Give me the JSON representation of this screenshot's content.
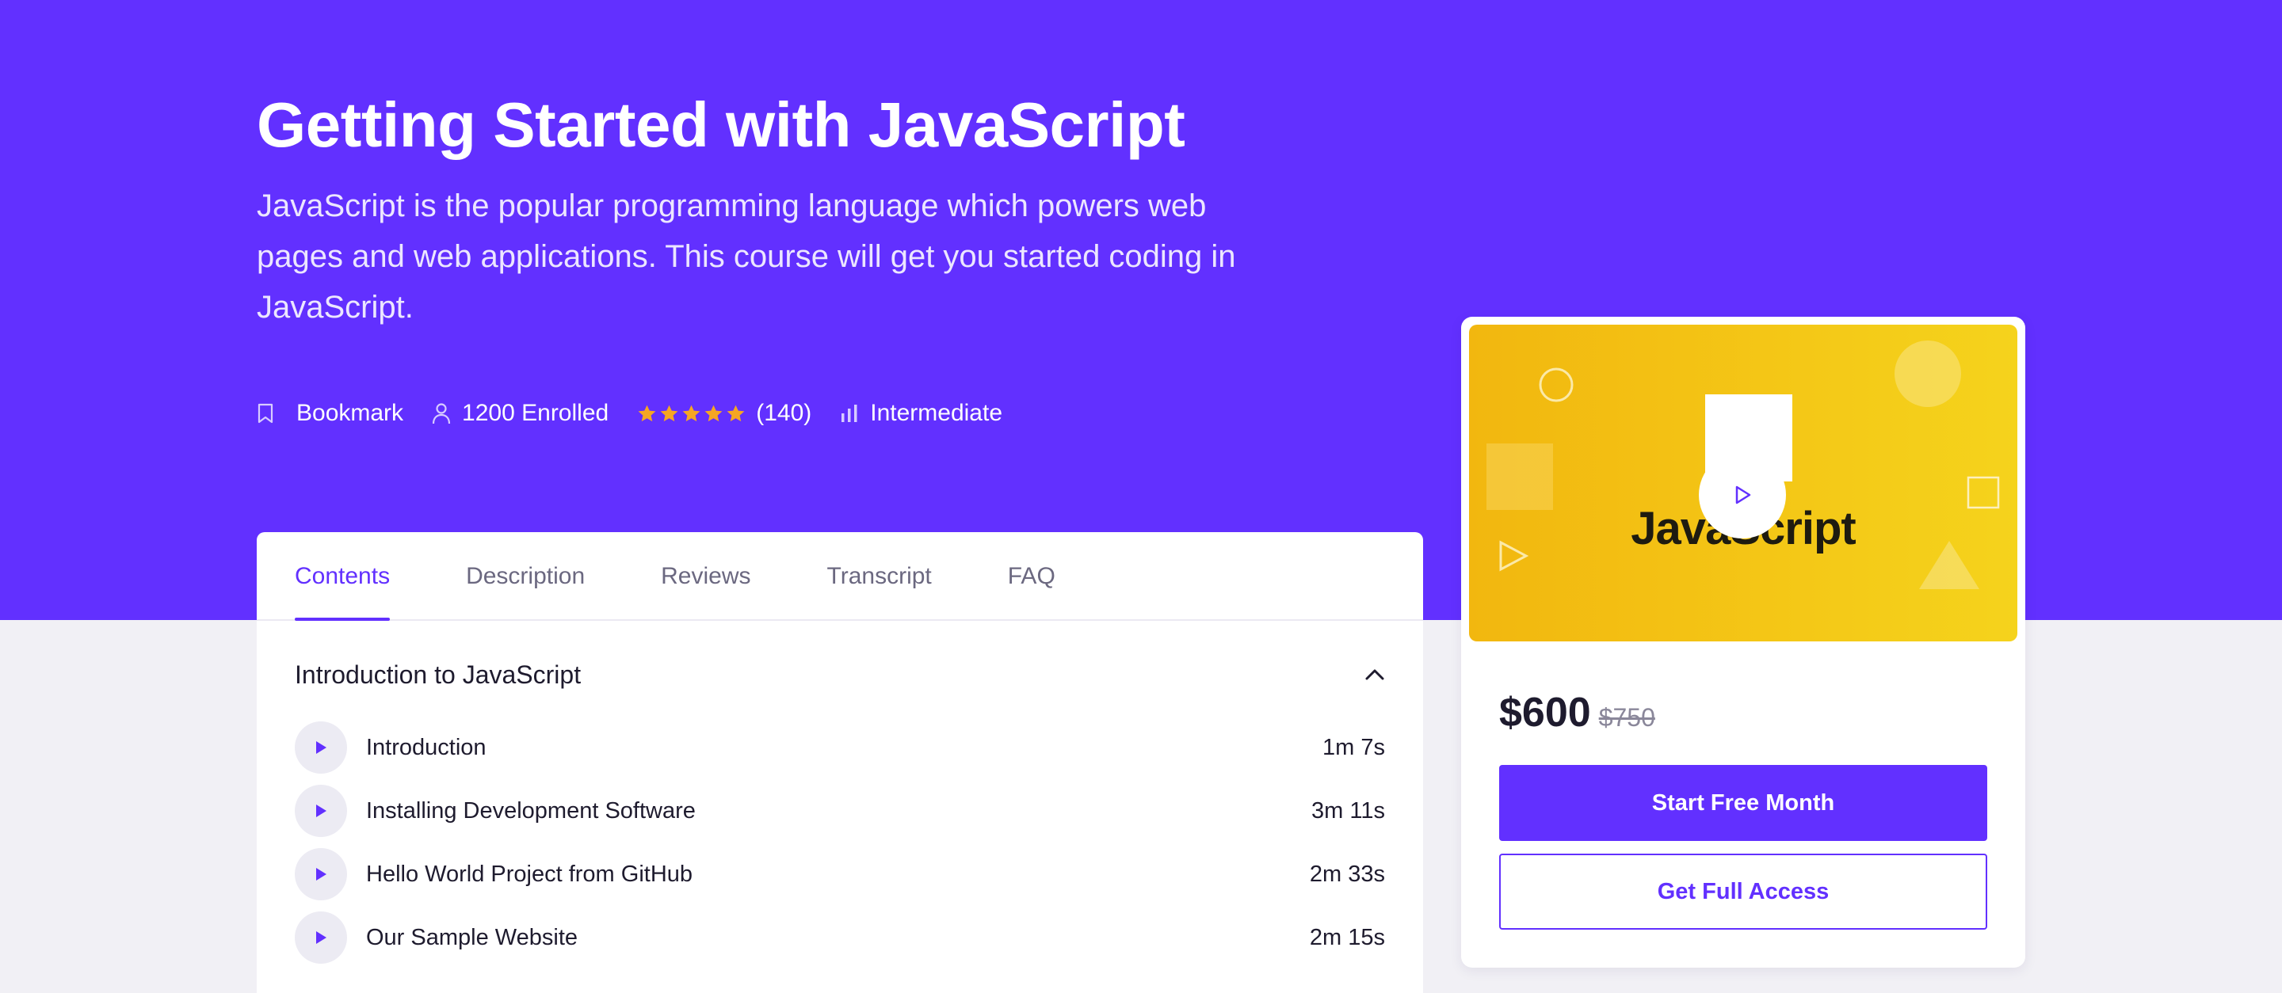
{
  "course": {
    "title": "Getting Started with JavaScript",
    "description": "JavaScript is the popular programming language which powers web pages and web applications. This course will get you started coding in JavaScript."
  },
  "meta": {
    "bookmark_label": "Bookmark",
    "enrolled_label": "1200 Enrolled",
    "rating_stars": 5,
    "rating_count": "(140)",
    "level_label": "Intermediate"
  },
  "tabs": [
    {
      "label": "Contents",
      "active": true
    },
    {
      "label": "Description",
      "active": false
    },
    {
      "label": "Reviews",
      "active": false
    },
    {
      "label": "Transcript",
      "active": false
    },
    {
      "label": "FAQ",
      "active": false
    }
  ],
  "section": {
    "title": "Introduction to JavaScript",
    "expanded": true
  },
  "lessons": [
    {
      "title": "Introduction",
      "duration": "1m 7s"
    },
    {
      "title": "Installing Development Software",
      "duration": "3m 11s"
    },
    {
      "title": "Hello World Project from GitHub",
      "duration": "2m 33s"
    },
    {
      "title": "Our Sample Website",
      "duration": "2m 15s"
    }
  ],
  "purchase": {
    "thumbnail_text": "JavaScript",
    "price": "$600",
    "old_price": "$750",
    "primary_button": "Start Free Month",
    "secondary_button": "Get Full Access"
  },
  "icons": {
    "bookmark": "bookmark-icon",
    "user": "user-icon",
    "star": "star-icon",
    "level": "bar-chart-icon",
    "chevron": "chevron-up-icon",
    "play": "play-icon"
  },
  "colors": {
    "brand": "#6230ff",
    "star": "#f5a623",
    "thumb_start": "#f2b70f",
    "thumb_end": "#f5d31c"
  }
}
